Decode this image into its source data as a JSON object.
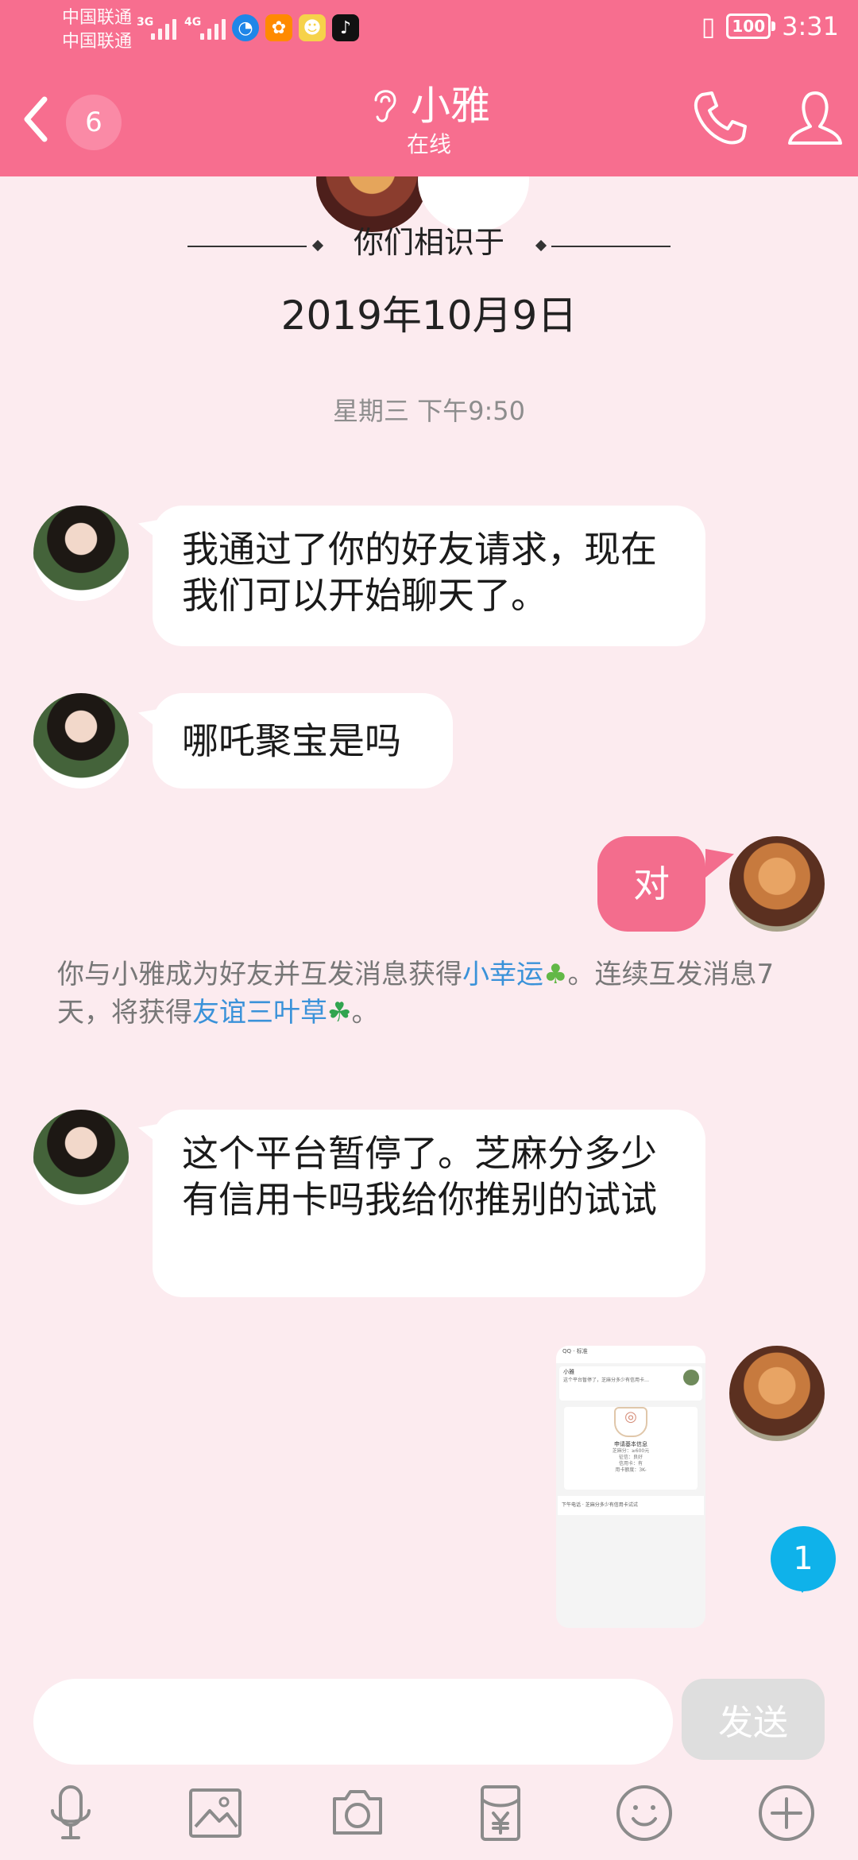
{
  "status_bar": {
    "carrier_1": "中国联通",
    "carrier_2": "中国联通",
    "network_1": "3G",
    "network_2": "4G",
    "battery": "100",
    "time": "3:31"
  },
  "header": {
    "unread_count": "6",
    "contact_name": "小雅",
    "contact_status": "在线"
  },
  "chat": {
    "met_label": "你们相识于",
    "met_date": "2019年10月9日",
    "timestamp": "星期三 下午9:50",
    "messages": [
      {
        "side": "left",
        "text": "我通过了你的好友请求，现在我们可以开始聊天了。"
      },
      {
        "side": "left",
        "text": "哪吒聚宝是吗"
      },
      {
        "side": "right",
        "text": "对"
      },
      {
        "side": "left",
        "text": "这个平台暂停了。芝麻分多少有信用卡吗我给你推别的试试"
      }
    ],
    "system_message": {
      "prefix": "你与小雅成为好友并互发消息获得",
      "link_1": "小幸运",
      "middle": "。连续互发消息7天，将获得",
      "link_2": "友谊三叶草",
      "suffix": "。"
    },
    "image_preview": {
      "topbar": "QQ · 标准",
      "name": "小雅",
      "subtitle": "这个平台暂停了，芝麻分多少有信用卡…",
      "card_title": "申请基本信息",
      "lines": [
        "芝麻分：≥600元",
        "征信：良好",
        "信用卡：有",
        "用卡额度：3K-"
      ],
      "footer": "下午电话 · 芝麻分多少有信用卡试试"
    },
    "floating_unread": "1"
  },
  "composer": {
    "send_label": "发送"
  },
  "colors": {
    "header": "#f76e8f",
    "background": "#fcebef",
    "my_bubble": "#f36d8d",
    "link": "#3a92d9",
    "badge": "#0fb2ea"
  }
}
